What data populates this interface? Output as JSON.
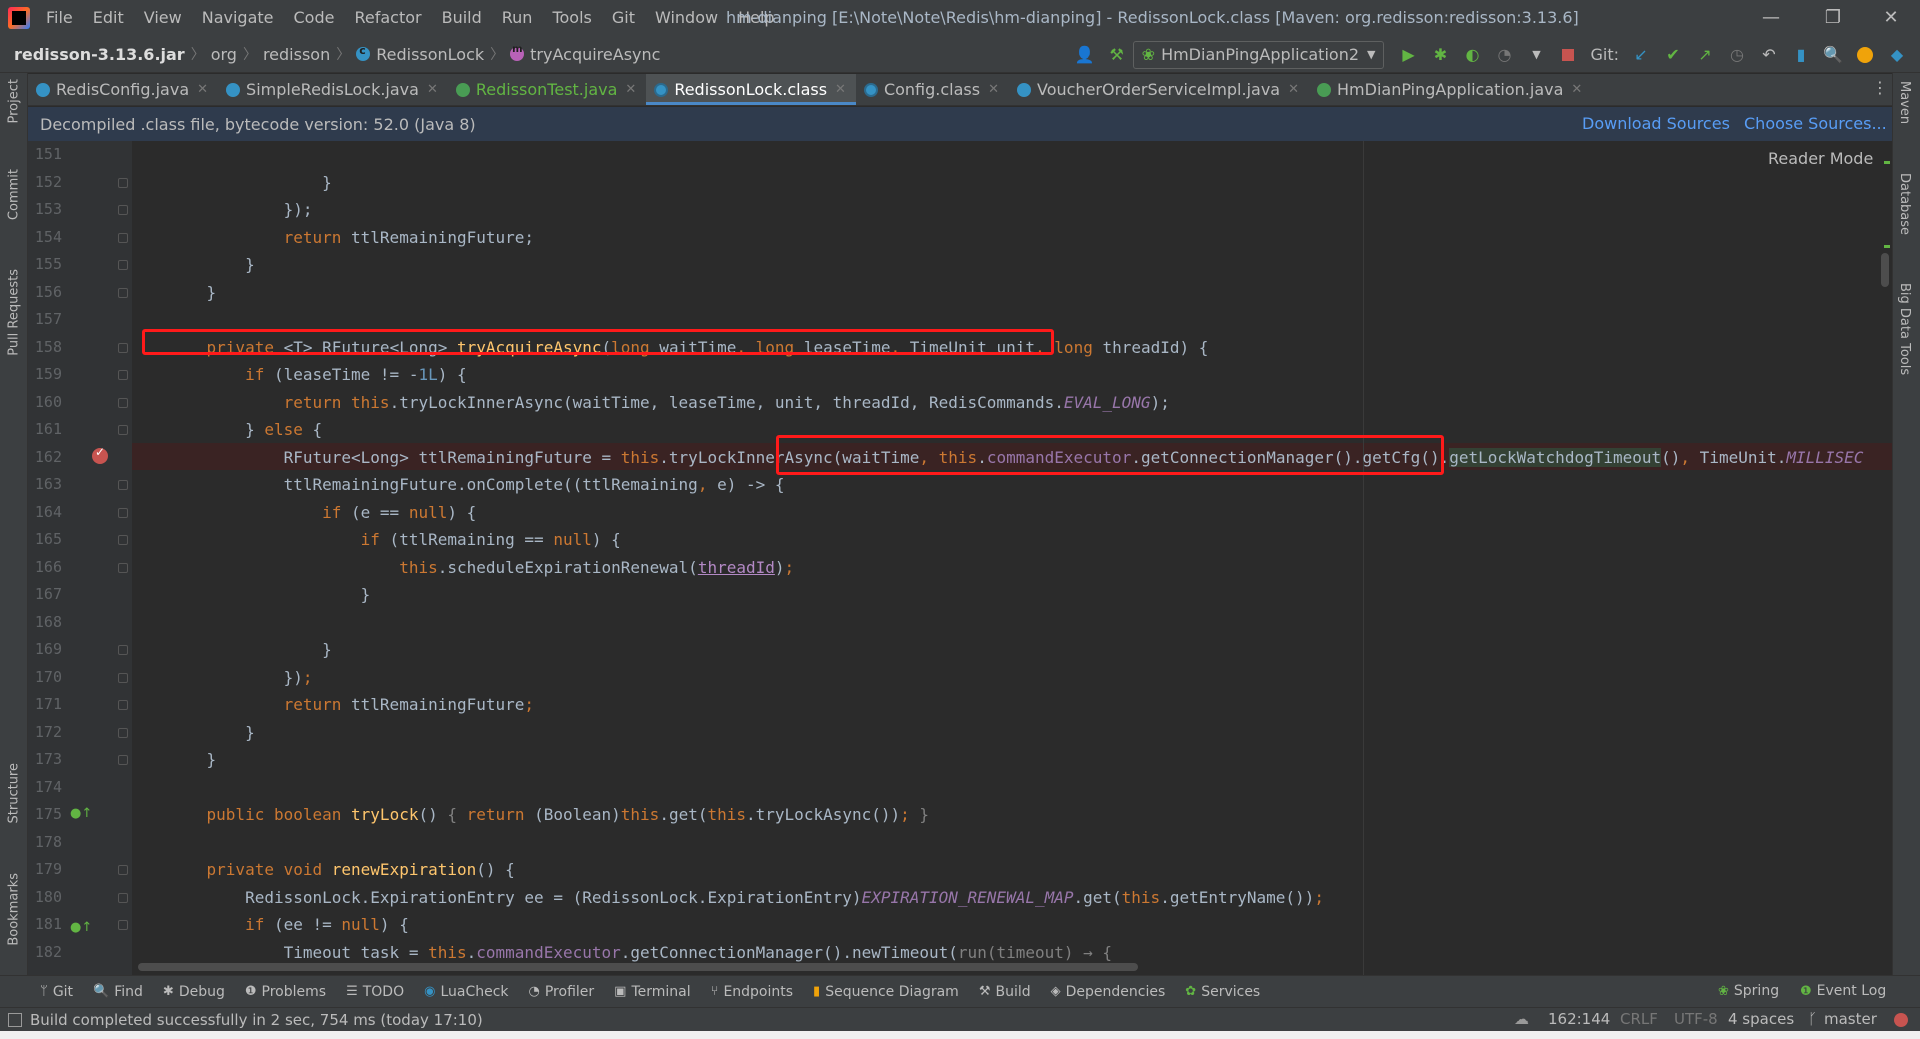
{
  "window": {
    "menu": [
      "File",
      "Edit",
      "View",
      "Navigate",
      "Code",
      "Refactor",
      "Build",
      "Run",
      "Tools",
      "Git",
      "Window",
      "Help"
    ],
    "title": "hm-dianping [E:\\Note\\Note\\Redis\\hm-dianping] - RedissonLock.class [Maven: org.redisson:redisson:3.13.6]",
    "minimize": "—",
    "restore": "❐",
    "close": "✕"
  },
  "breadcrumb": {
    "jar": "redisson-3.13.6.jar",
    "pkg1": "org",
    "pkg2": "redisson",
    "cls": "RedissonLock",
    "method": "tryAcquireAsync"
  },
  "toolbar": {
    "run_config": "HmDianPingApplication2",
    "git_label": "Git:"
  },
  "tabs": [
    {
      "label": "RedisConfig.java"
    },
    {
      "label": "SimpleRedisLock.java"
    },
    {
      "label": "RedissonTest.java"
    },
    {
      "label": "RedissonLock.class"
    },
    {
      "label": "Config.class"
    },
    {
      "label": "VoucherOrderServiceImpl.java"
    },
    {
      "label": "HmDianPingApplication.java"
    }
  ],
  "banner": {
    "text": "Decompiled .class file, bytecode version: 52.0 (Java 8)",
    "download_sources": "Download Sources",
    "choose_sources": "Choose Sources..."
  },
  "editor": {
    "reader_mode": "Reader Mode",
    "line_numbers": [
      "151",
      "152",
      "153",
      "154",
      "155",
      "156",
      "157",
      "158",
      "159",
      "160",
      "161",
      "162",
      "163",
      "164",
      "165",
      "166",
      "167",
      "168",
      "169",
      "170",
      "171",
      "172",
      "173",
      "174",
      "175",
      "178",
      "179",
      "180",
      "181",
      "182"
    ]
  },
  "left_tools": [
    "Project",
    "Commit",
    "Pull Requests",
    "Structure",
    "Bookmarks"
  ],
  "right_tools": [
    "Maven",
    "Database",
    "Big Data Tools"
  ],
  "bottom_tools": [
    "Git",
    "Find",
    "Debug",
    "Problems",
    "TODO",
    "LuaCheck",
    "Profiler",
    "Terminal",
    "Endpoints",
    "Sequence Diagram",
    "Build",
    "Dependencies",
    "Services",
    "Spring",
    "Event Log"
  ],
  "status": {
    "message": "Build completed successfully in 2 sec, 754 ms (today 17:10)",
    "position": "162:144",
    "line_sep": "CRLF",
    "encoding": "UTF-8",
    "indent": "4 spaces",
    "branch": "master"
  }
}
